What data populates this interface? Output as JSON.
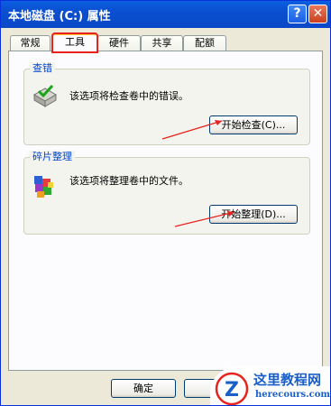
{
  "window": {
    "title": "本地磁盘 (C:) 属性",
    "help_symbol": "?",
    "close_symbol": "✕"
  },
  "tabs": [
    {
      "label": "常规",
      "active": false
    },
    {
      "label": "工具",
      "active": true
    },
    {
      "label": "硬件",
      "active": false
    },
    {
      "label": "共享",
      "active": false
    },
    {
      "label": "配额",
      "active": false
    }
  ],
  "error_check": {
    "group_label": "查错",
    "description": "该选项将检查卷中的错误。",
    "button_label": "开始检查(C)...",
    "icon": "disk-check-icon"
  },
  "defrag": {
    "group_label": "碎片整理",
    "description": "该选项将整理卷中的文件。",
    "button_label": "开始整理(D)...",
    "icon": "defrag-icon"
  },
  "footer": {
    "ok_label": "确定"
  },
  "watermark": {
    "title": "这里教程网",
    "url": "herecours.com",
    "logo_letter": "Z"
  },
  "colors": {
    "accent_red": "#e8221c",
    "title_bar": "#0a5fe0",
    "group_label": "#0046d5"
  }
}
